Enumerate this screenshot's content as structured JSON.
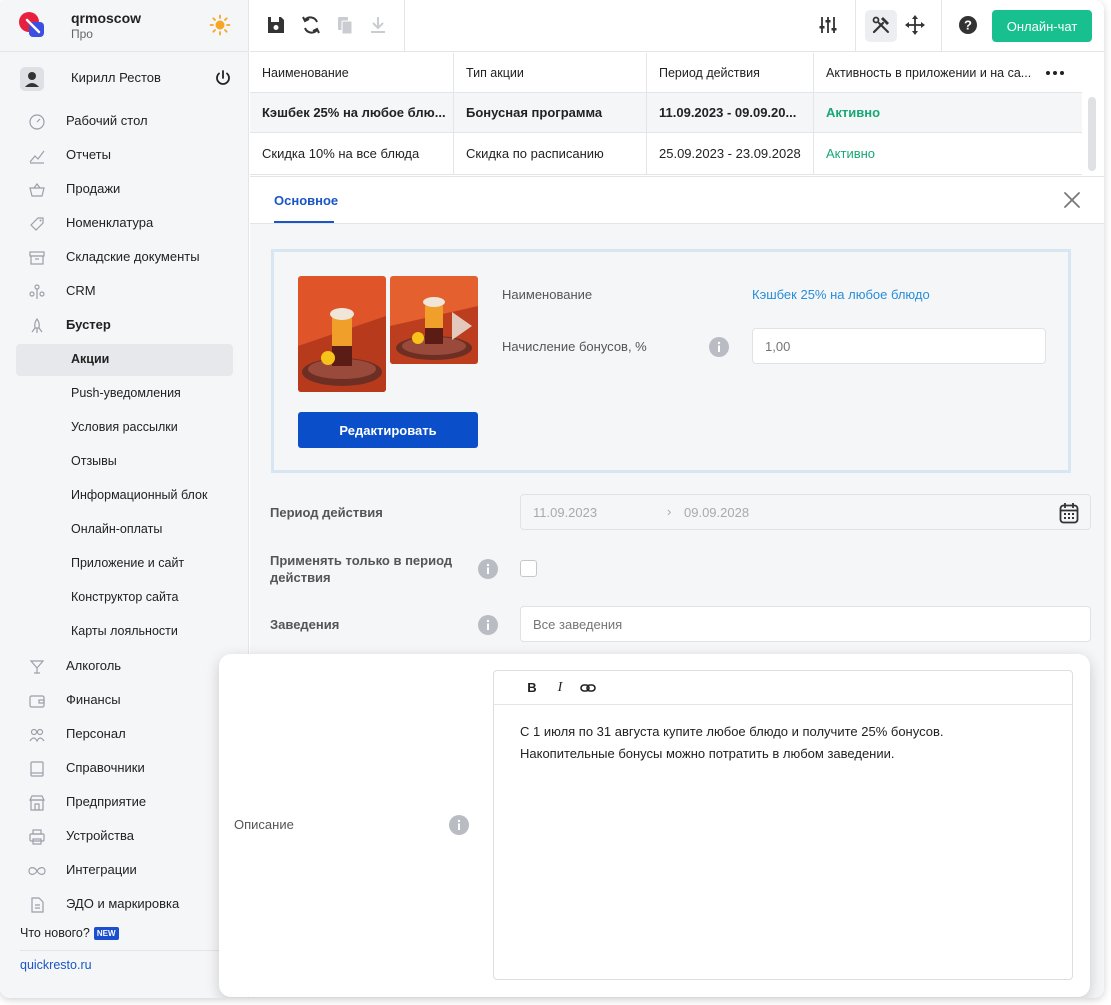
{
  "brand": {
    "name": "qrmoscow",
    "plan": "Про"
  },
  "user": {
    "name": "Кирилл Рестов"
  },
  "sidebar": {
    "items": [
      {
        "label": "Рабочий стол",
        "icon": "gauge-icon"
      },
      {
        "label": "Отчеты",
        "icon": "chart-icon"
      },
      {
        "label": "Продажи",
        "icon": "basket-icon"
      },
      {
        "label": "Номенклатура",
        "icon": "tag-icon"
      },
      {
        "label": "Складские документы",
        "icon": "archive-icon"
      },
      {
        "label": "CRM",
        "icon": "people-icon"
      },
      {
        "label": "Бустер",
        "icon": "booster-icon"
      }
    ],
    "sub_items": [
      "Акции",
      "Push-уведомления",
      "Условия рассылки",
      "Отзывы",
      "Информационный блок",
      "Онлайн-оплаты",
      "Приложение и сайт",
      "Конструктор сайта",
      "Карты лояльности"
    ],
    "items_bottom": [
      {
        "label": "Алкоголь",
        "icon": "cocktail-icon"
      },
      {
        "label": "Финансы",
        "icon": "wallet-icon"
      },
      {
        "label": "Персонал",
        "icon": "staff-icon"
      },
      {
        "label": "Справочники",
        "icon": "book-icon"
      },
      {
        "label": "Предприятие",
        "icon": "store-icon"
      },
      {
        "label": "Устройства",
        "icon": "printer-icon"
      },
      {
        "label": "Интеграции",
        "icon": "infinity-icon"
      },
      {
        "label": "ЭДО и маркировка",
        "icon": "document-icon"
      }
    ],
    "whats_new": "Что нового?",
    "new_badge": "NEW",
    "site_link": "quickresto.ru"
  },
  "toolbar": {
    "chat_label": "Онлайн-чат"
  },
  "table": {
    "columns": [
      "Наименование",
      "Тип акции",
      "Период действия",
      "Активность в приложении и на са..."
    ],
    "rows": [
      [
        "Кэшбек 25% на любое блю...",
        "Бонусная программа",
        "11.09.2023 - 09.09.20...",
        "Активно"
      ],
      [
        "Скидка 10% на все блюда",
        "Скидка по расписанию",
        "25.09.2023 - 23.09.2028",
        "Активно"
      ]
    ]
  },
  "detail": {
    "tab": "Основное",
    "name_label": "Наименование",
    "name_value": "Кэшбек 25% на любое блюдо",
    "bonus_label": "Начисление бонусов, %",
    "bonus_placeholder": "1,00",
    "edit_button": "Редактировать",
    "period_label": "Период действия",
    "period_from": "11.09.2023",
    "period_arrow": "›",
    "period_to": "09.09.2028",
    "only_period_label_line1": "Применять только в период",
    "only_period_label_line2": "действия",
    "venues_label": "Заведения",
    "venues_placeholder": "Все заведения",
    "description_label": "Описание",
    "description_line1": "С 1 июля по 31 августа купите любое блюдо и получите 25% бонусов.",
    "description_line2": "Накопительные бонусы можно потратить в любом заведении.",
    "editor_bold": "B",
    "editor_italic": "I"
  },
  "colors": {
    "accent": "#1a56c4",
    "primary_button": "#0a4fc9",
    "chat_button": "#18c08f",
    "status_active": "#18a874"
  }
}
